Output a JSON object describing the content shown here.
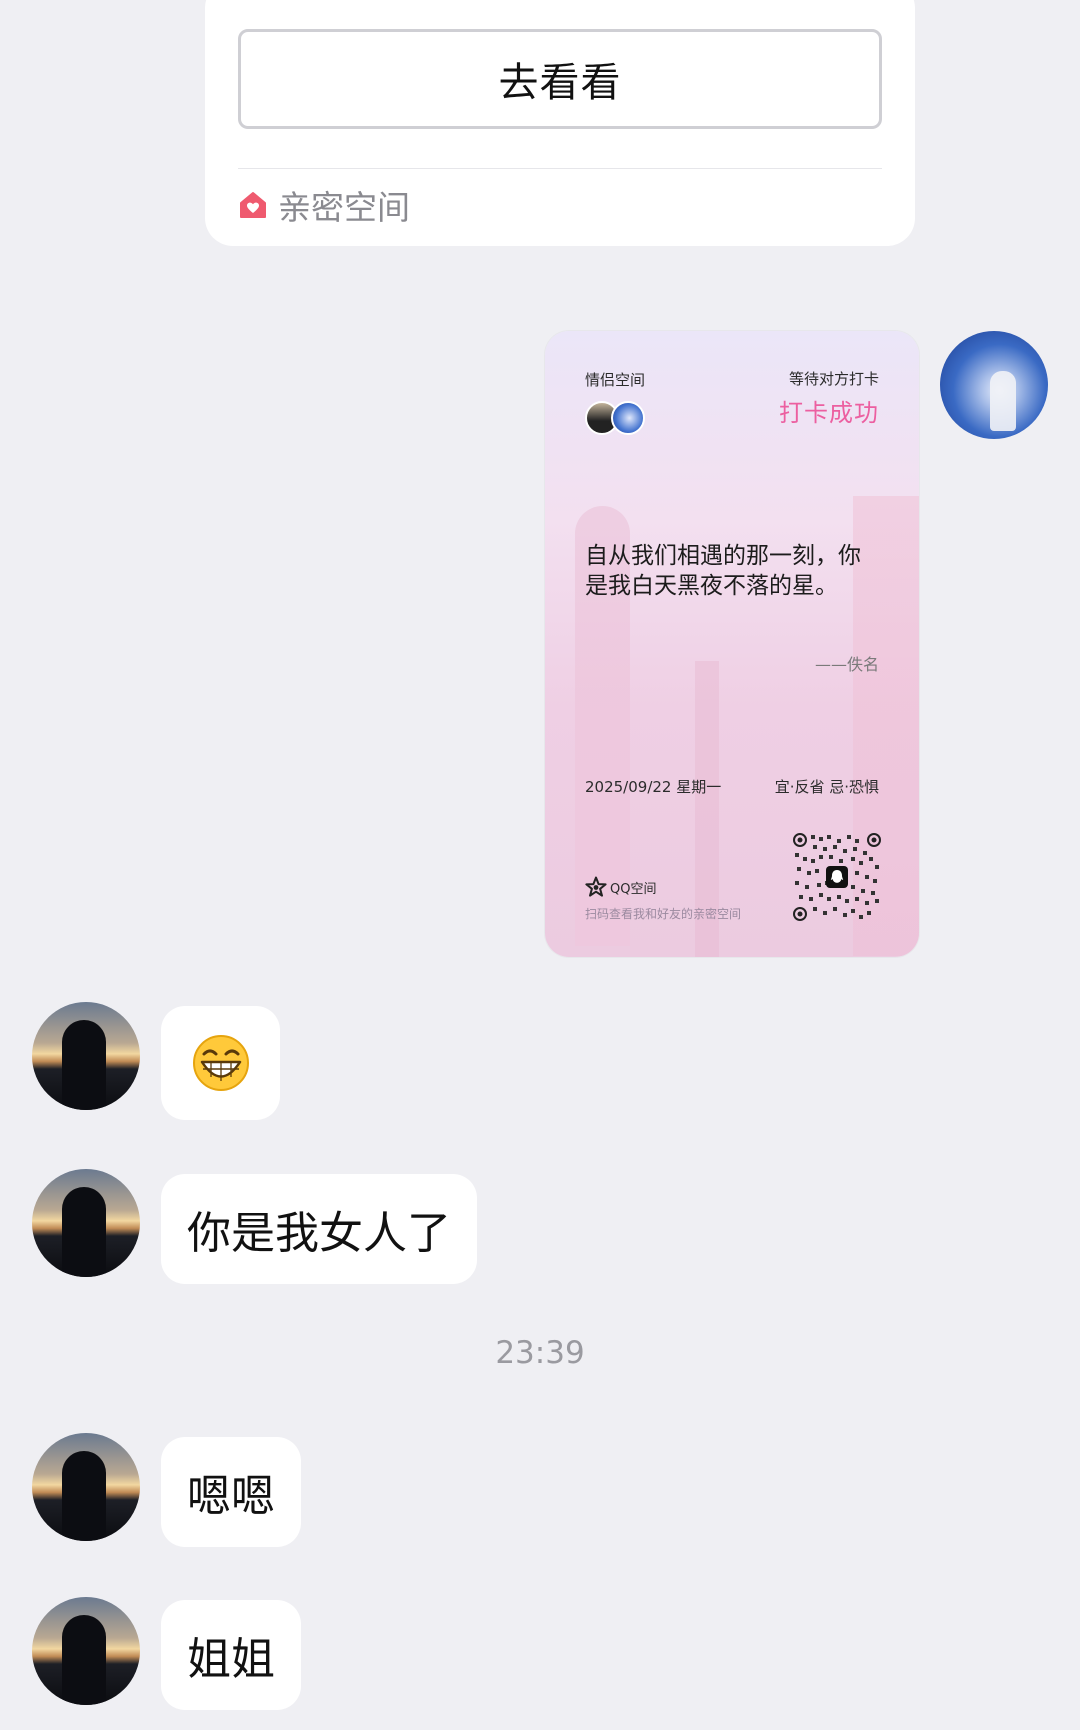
{
  "share_card": {
    "button_label": "去看看",
    "source_label": "亲密空间",
    "source_icon": "home-heart-icon",
    "accent_color": "#ef5a6f"
  },
  "checkin_card": {
    "space_title": "情侣空间",
    "waiting_label": "等待对方打卡",
    "status_label": "打卡成功",
    "quote": "自从我们相遇的那一刻，你是我白天黑夜不落的星。",
    "author": "——佚名",
    "date": "2025/09/22 星期一",
    "almanac": "宜·反省 忌·恐惧",
    "brand": "QQ空间",
    "scan_tip": "扫码查看我和好友的亲密空间",
    "status_color": "#ec5fa0"
  },
  "messages": [
    {
      "type": "emoji",
      "emoji_name": "grinning-face-icon"
    },
    {
      "type": "text",
      "text": "你是我女人了"
    },
    {
      "type": "text",
      "text": "嗯嗯"
    },
    {
      "type": "text",
      "text": "姐姐"
    }
  ],
  "timestamp": "23:39"
}
